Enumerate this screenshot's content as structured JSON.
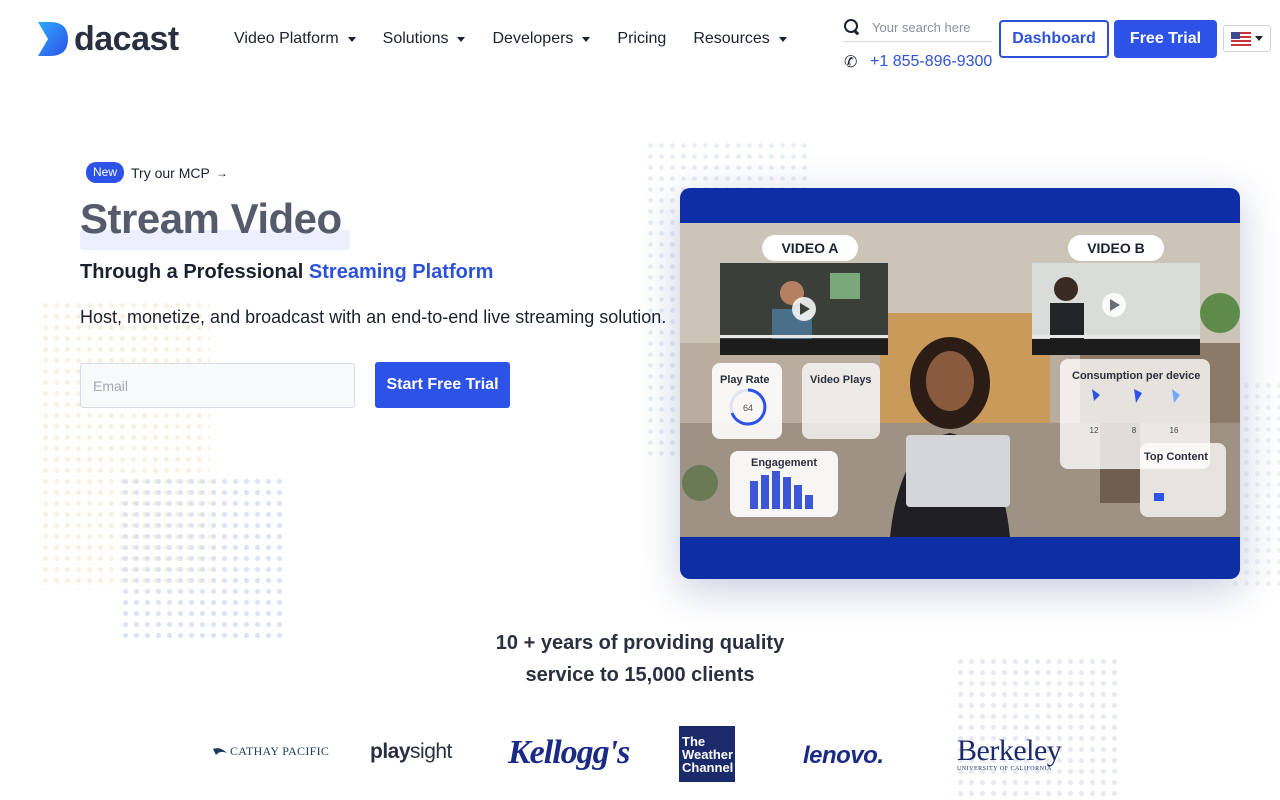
{
  "header": {
    "logo_text": "dacast",
    "nav": [
      {
        "label": "Video Platform",
        "has_dropdown": true
      },
      {
        "label": "Solutions",
        "has_dropdown": true
      },
      {
        "label": "Developers",
        "has_dropdown": true
      },
      {
        "label": "Pricing",
        "has_dropdown": false
      },
      {
        "label": "Resources",
        "has_dropdown": true
      }
    ],
    "search_placeholder": "Your search here",
    "phone": "+1 855-896-9300",
    "dashboard_label": "Dashboard",
    "free_trial_label": "Free Trial",
    "language_flag": "us-flag-icon"
  },
  "hero": {
    "badge": "New",
    "mcp_text": "Try our MCP",
    "title": "Stream Video",
    "subtitle_prefix": "Through a Professional ",
    "subtitle_accent": "Streaming Platform",
    "description": "Host, monetize, and broadcast with an end-to-end live streaming solution.",
    "email_placeholder": "Email",
    "cta_label": "Start Free Trial"
  },
  "video": {
    "video_a_label": "VIDEO A",
    "video_b_label": "VIDEO B",
    "play_rate_label": "Play Rate",
    "play_rate_value": "64",
    "video_plays_label": "Video Plays",
    "consumption_label": "Consumption per device",
    "consumption_values": [
      "12",
      "8",
      "16"
    ],
    "engagement_label": "Engagement",
    "top_content_label": "Top Content"
  },
  "trust": {
    "line1": "10 + years of providing quality",
    "line2": "service to 15,000 clients"
  },
  "clients": {
    "cathay": "CATHAY PACIFIC",
    "playsight_a": "play",
    "playsight_b": "sight",
    "kelloggs": "Kellogg's",
    "weather_1": "The",
    "weather_2": "Weather",
    "weather_3": "Channel",
    "lenovo": "lenovo.",
    "berkeley": "Berkeley",
    "berkeley_sub": "UNIVERSITY OF CALIFORNIA"
  },
  "colors": {
    "brand_blue": "#2d52e8",
    "video_frame": "#0e2ea6",
    "text_dark": "#1c2130"
  }
}
